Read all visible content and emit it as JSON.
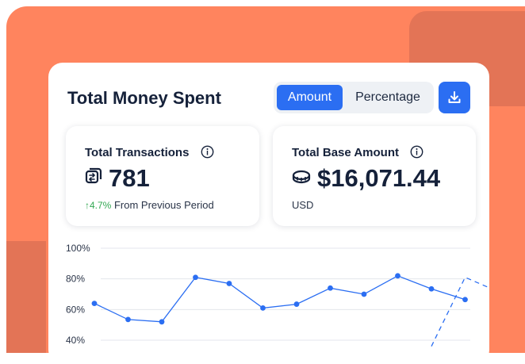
{
  "header": {
    "title": "Total Money Spent",
    "toggle": {
      "options": [
        "Amount",
        "Percentage"
      ],
      "selected": "Amount"
    },
    "download_icon": "download-icon"
  },
  "stats": {
    "transactions": {
      "label": "Total Transactions",
      "value": "781",
      "icon": "transfer-icon",
      "change_arrow": "↑",
      "change_pct": "4.7%",
      "change_text": "From Previous Period"
    },
    "base_amount": {
      "label": "Total Base Amount",
      "value": "$16,071.44",
      "icon": "coins-icon",
      "currency": "USD"
    }
  },
  "colors": {
    "accent": "#2B6EF2",
    "background": "#FF845E",
    "positive": "#33A853"
  },
  "chart_data": {
    "type": "line",
    "title": "",
    "y_ticks": [
      "100%",
      "80%",
      "60%",
      "40%"
    ],
    "ylim": [
      40,
      100
    ],
    "grid": true,
    "series": [
      {
        "values": [
          64,
          53.5,
          52,
          81,
          77,
          61,
          63.5,
          74,
          70,
          82,
          73.5,
          66.5
        ]
      },
      {
        "style": "dashed",
        "values": [
          null,
          null,
          null,
          null,
          null,
          null,
          null,
          null,
          null,
          null,
          36,
          81,
          71.5
        ]
      }
    ]
  }
}
